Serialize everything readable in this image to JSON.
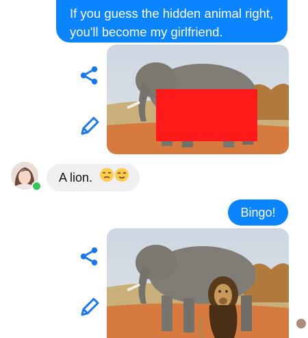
{
  "conversation": {
    "message_1": "If you guess the hidden animal right, you'll become my girlfriend.",
    "reply": "A lion.",
    "message_2": "Bingo!"
  },
  "icons": {
    "share": "share-icon",
    "edit": "pencil-icon",
    "emoji": "unamused-face-emoji",
    "emoji_2": "smiling-face-emoji"
  },
  "colors": {
    "outgoing_bubble": "#0a84ff",
    "incoming_bubble": "#f0f0f2",
    "icon_accent": "#1877f2",
    "online_dot": "#34c759",
    "hidden_block": "#ff1a1a"
  }
}
